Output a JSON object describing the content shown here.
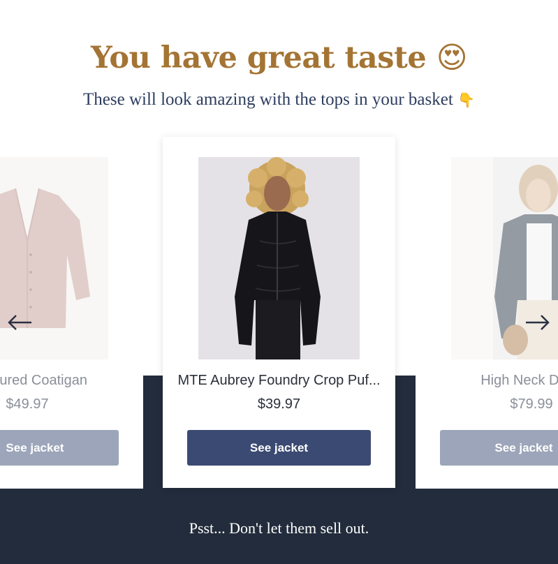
{
  "header": {
    "title": "You have great taste",
    "title_emoji": "😍",
    "subtitle": "These will look amazing with the tops in your basket",
    "subtitle_emoji": "👇"
  },
  "products": [
    {
      "name": "l Textured Coatigan",
      "price": "$49.97",
      "button": "See jacket",
      "image_icon": "cardigan-icon"
    },
    {
      "name": "MTE Aubrey Foundry Crop Puf...",
      "price": "$39.97",
      "button": "See jacket",
      "image_icon": "puffer-jacket-icon"
    },
    {
      "name": "High Neck Denir",
      "price": "$79.99",
      "button": "See jacket",
      "image_icon": "denim-jacket-icon"
    }
  ],
  "nav": {
    "prev_icon": "arrow-left-icon",
    "next_icon": "arrow-right-icon"
  },
  "footer": {
    "text": "Psst... Don't let them sell out."
  },
  "colors": {
    "headline": "#a47434",
    "subhead": "#2e3d5f",
    "band": "#222c3c",
    "primary_button": "#3b4a72",
    "muted_button": "#9ca5b9"
  }
}
